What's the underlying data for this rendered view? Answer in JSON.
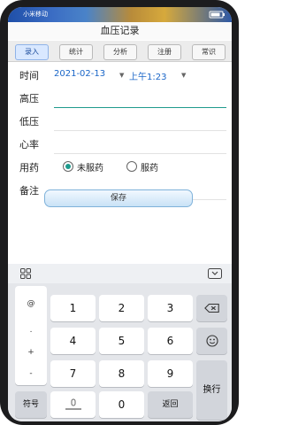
{
  "status": {
    "carrier": "小米移动"
  },
  "app": {
    "title": "血压记录"
  },
  "tabs": [
    {
      "label": "录入",
      "active": true
    },
    {
      "label": "统计",
      "active": false
    },
    {
      "label": "分析",
      "active": false
    },
    {
      "label": "注册",
      "active": false
    },
    {
      "label": "常识",
      "active": false
    }
  ],
  "form": {
    "time_label": "时间",
    "date_value": "2021-02-13",
    "time_value": "上午1:23",
    "high_label": "高压",
    "low_label": "低压",
    "heart_label": "心率",
    "med_label": "用药",
    "med_option_no": "未服药",
    "med_option_yes": "服药",
    "med_selected": "未服药",
    "note_label": "备注",
    "save_label": "保存"
  },
  "keyboard": {
    "side_keys": [
      "@",
      ".",
      "+",
      "-"
    ],
    "digits": [
      "1",
      "2",
      "3",
      "4",
      "5",
      "6",
      "7",
      "8",
      "9",
      "0"
    ],
    "symbol_label": "符号",
    "back_label": "返回",
    "enter_label": "换行"
  },
  "colors": {
    "accent": "#1f9b8d",
    "link": "#1a66c8",
    "save_border": "#7fb2da"
  }
}
